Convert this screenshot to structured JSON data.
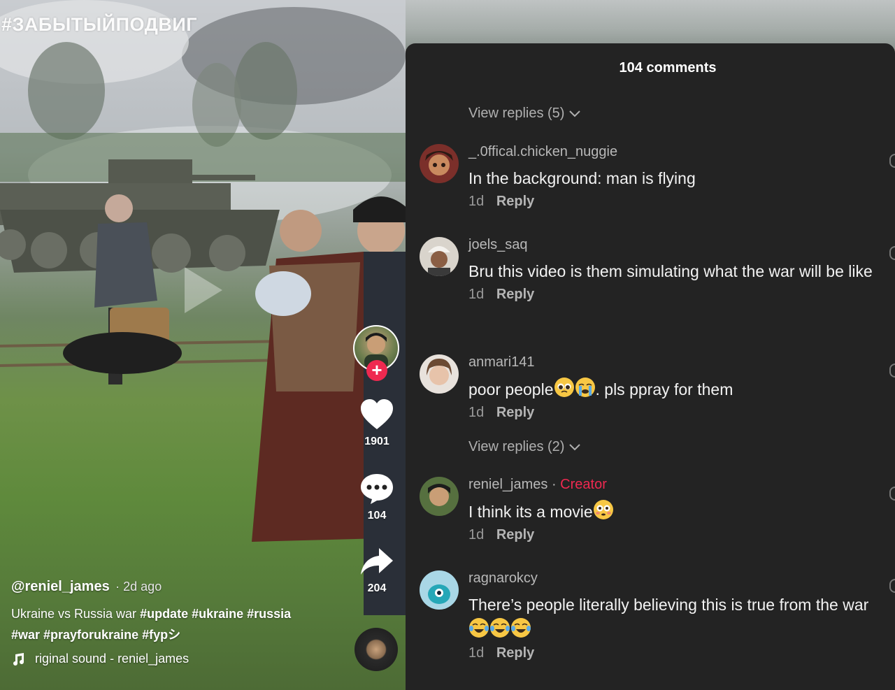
{
  "video": {
    "hashtag_title": "#ЗАБЫТЫЙПОДВИГ",
    "username": "@reniel_james",
    "posted": "· 2d ago",
    "description_plain": "Ukraine vs Russia war ",
    "tags_line1": "#update #ukraine #russia",
    "tags_line2": "#war #prayforukraine #fypシ",
    "sound": "riginal sound - reniel_james",
    "likes": "1901",
    "comments": "104",
    "shares": "204",
    "follow_symbol": "+"
  },
  "comments_panel": {
    "title": "104 comments",
    "view_replies_1": "View replies (5)",
    "view_replies_2": "View replies (2)",
    "items": [
      {
        "username": "_.0ffical.chicken_nuggie",
        "text": "In the background: man is flying",
        "age": "1d",
        "reply": "Reply"
      },
      {
        "username": "joels_saq",
        "text": "Bru this video is them simulating what the war will be like",
        "age": "1d",
        "reply": "Reply"
      },
      {
        "username": "anmari141",
        "text": "poor people",
        "text_after": ". pls ppray for them",
        "age": "1d",
        "reply": "Reply"
      },
      {
        "username": "reniel_james",
        "creator_tag": "Creator",
        "creator_sep": " · ",
        "text": "I think its a movie",
        "age": "1d",
        "reply": "Reply"
      },
      {
        "username": "ragnarokcy",
        "text": "There’s people literally believing this is true from the war",
        "age": "1d",
        "reply": "Reply"
      }
    ]
  },
  "colors": {
    "panel_bg": "#232323",
    "accent_red": "#ef2950",
    "muted_text": "#b0b0b0"
  }
}
